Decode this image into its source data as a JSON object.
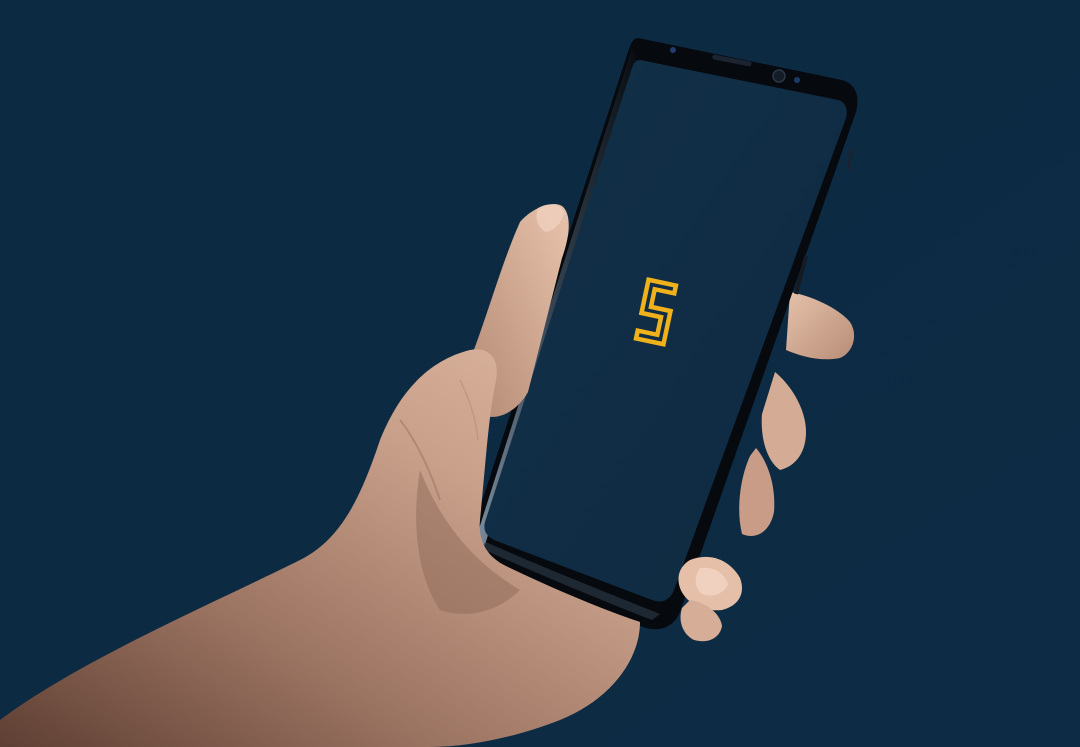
{
  "scene": {
    "description_free": true,
    "colors": {
      "background": "#0d2a42",
      "screen": "#0f2b43",
      "phone_body": "#06090d",
      "phone_edge_highlight": "#5a6e82",
      "logo": "#f0b21b",
      "skin_light": "#e3bca4",
      "skin_mid": "#c89a82",
      "skin_shadow": "#6e4a3c"
    },
    "phone": {
      "device": "smartphone",
      "screen_state": "splash",
      "logo_icon": "s-monogram-icon"
    }
  }
}
